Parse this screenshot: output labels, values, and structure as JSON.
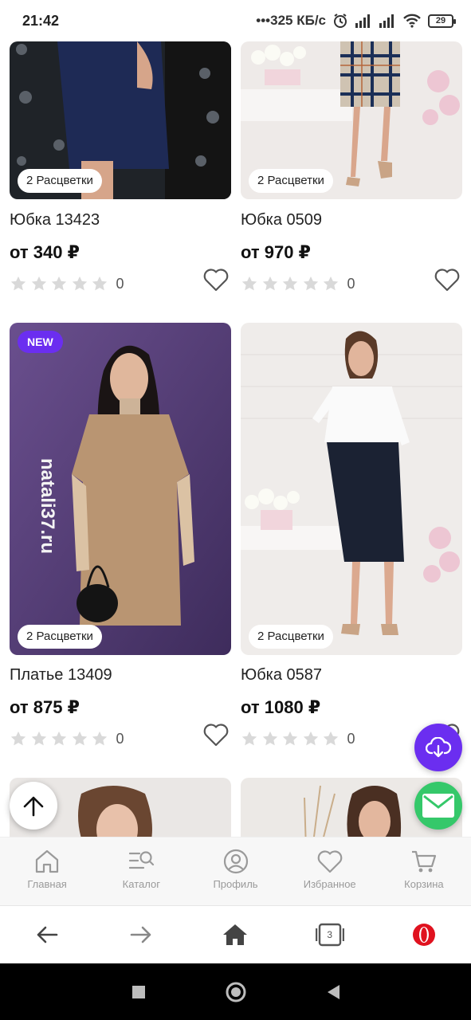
{
  "status_bar": {
    "time": "21:42",
    "network_speed": "325 КБ/с",
    "battery_level": "29",
    "icons": [
      "dots-icon",
      "alarm-icon",
      "signal-icon",
      "signal-icon",
      "wifi-icon",
      "battery-icon"
    ]
  },
  "products": [
    {
      "title": "Юбка 13423",
      "price": "от 340 ₽",
      "colors_badge": "2 Расцветки",
      "rating_count": "0",
      "stars": 0,
      "is_new": false
    },
    {
      "title": "Юбка 0509",
      "price": "от 970 ₽",
      "colors_badge": "2 Расцветки",
      "rating_count": "0",
      "stars": 0,
      "is_new": false
    },
    {
      "title": "Платье 13409",
      "price": "от 875 ₽",
      "colors_badge": "2 Расцветки",
      "rating_count": "0",
      "stars": 0,
      "is_new": true,
      "new_badge": "NEW"
    },
    {
      "title": "Юбка 0587",
      "price": "от 1080 ₽",
      "colors_badge": "2 Расцветки",
      "rating_count": "0",
      "stars": 0,
      "is_new": false
    }
  ],
  "app_nav": {
    "items": [
      {
        "label": "Главная",
        "icon": "home-icon"
      },
      {
        "label": "Каталог",
        "icon": "catalog-search-icon"
      },
      {
        "label": "Профиль",
        "icon": "profile-icon"
      },
      {
        "label": "Избранное",
        "icon": "heart-icon"
      },
      {
        "label": "Корзина",
        "icon": "cart-icon"
      }
    ]
  },
  "browser_bar": {
    "tabs_count": "3",
    "icons": [
      "back-arrow-icon",
      "forward-arrow-icon",
      "home-icon",
      "tabs-icon",
      "opera-icon"
    ]
  },
  "colors": {
    "accent_purple": "#6b2ef0",
    "mail_green": "#35c86a",
    "star_gray": "#d9d9d9",
    "nav_gray": "#9a9a9a"
  }
}
